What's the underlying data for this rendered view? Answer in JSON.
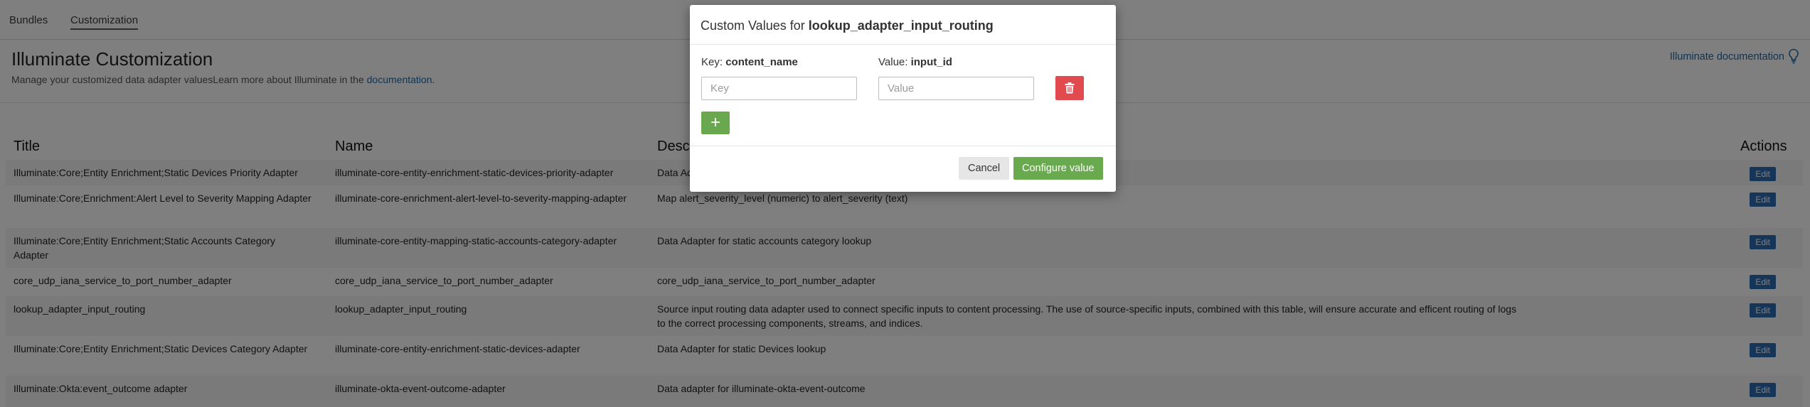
{
  "tabs": [
    {
      "label": "Bundles",
      "active": false
    },
    {
      "label": "Customization",
      "active": true
    }
  ],
  "header": {
    "title": "Illuminate Customization",
    "subtitle_text": "Manage your customized data adapter valuesLearn more about Illuminate in the ",
    "subtitle_link": "documentation",
    "subtitle_end": ".",
    "doc_link": "Illuminate documentation",
    "doc_icon": "lightbulb-icon"
  },
  "table": {
    "columns": [
      "Title",
      "Name",
      "Description",
      "Actions"
    ],
    "edit_label": "Edit",
    "rows": [
      {
        "title": "Illuminate:Core;Entity Enrichment;Static Devices Priority Adapter",
        "name": "illuminate-core-entity-enrichment-static-devices-priority-adapter",
        "description": "Data Adapter for static devices priority lookup"
      },
      {
        "title": "Illuminate:Core;Enrichment:Alert Level to Severity Mapping Adapter",
        "name": "illuminate-core-enrichment-alert-level-to-severity-mapping-adapter",
        "description": "Map alert_severity_level (numeric) to alert_severity (text)"
      },
      {
        "title": "Illuminate:Core;Entity Enrichment;Static Accounts Category Adapter",
        "name": "illuminate-core-entity-mapping-static-accounts-category-adapter",
        "description": "Data Adapter for static accounts category lookup"
      },
      {
        "title": "core_udp_iana_service_to_port_number_adapter",
        "name": "core_udp_iana_service_to_port_number_adapter",
        "description": "core_udp_iana_service_to_port_number_adapter"
      },
      {
        "title": "lookup_adapter_input_routing",
        "name": "lookup_adapter_input_routing",
        "description": "Source input routing data adapter used to connect specific inputs to content processing. The use of source-specific inputs, combined with this table, will ensure accurate and efficent routing of logs to the correct processing components, streams, and indices."
      },
      {
        "title": "Illuminate:Core;Entity Enrichment;Static Devices Category Adapter",
        "name": "illuminate-core-entity-enrichment-static-devices-adapter",
        "description": "Data Adapter for static Devices lookup"
      },
      {
        "title": "Illuminate:Okta:event_outcome adapter",
        "name": "illuminate-okta-event-outcome-adapter",
        "description": "Data adapter for illuminate-okta-event-outcome"
      }
    ]
  },
  "modal": {
    "title_prefix": "Custom Values for ",
    "title_name": "lookup_adapter_input_routing",
    "key_label": "Key: ",
    "key_name": "content_name",
    "value_label": "Value: ",
    "value_name": "input_id",
    "key_value": "",
    "key_placeholder": "Key",
    "value_value": "",
    "value_placeholder": "Value",
    "delete_icon": "trash-icon",
    "add_icon": "plus-icon",
    "add_symbol": "+",
    "cancel_label": "Cancel",
    "configure_label": "Configure value"
  },
  "colors": {
    "link": "#1d68a8",
    "danger": "#e14a4f",
    "success": "#6aa84f",
    "edit_button": "#2a6cb3"
  }
}
